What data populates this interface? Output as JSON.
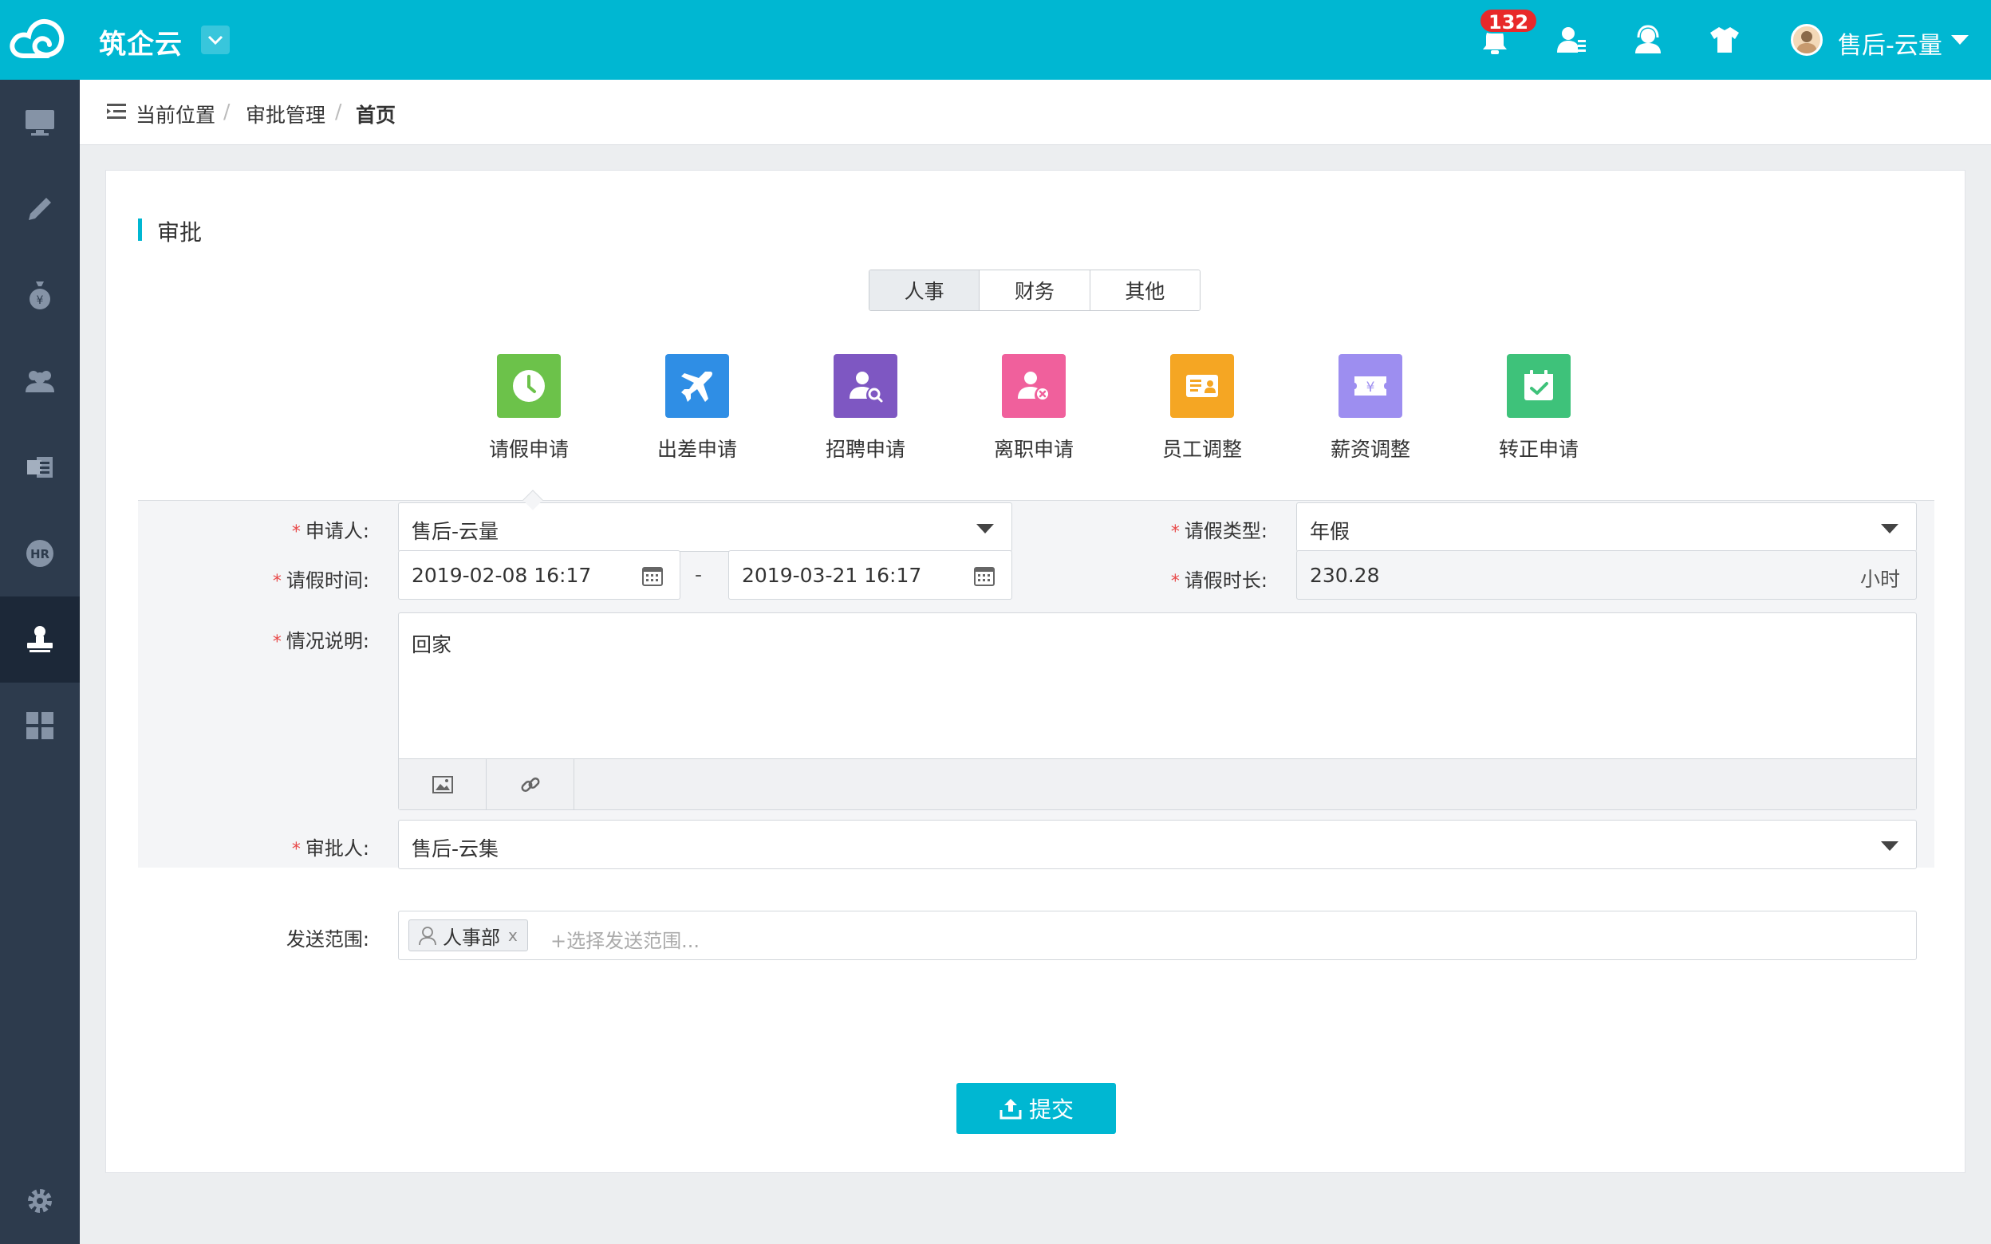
{
  "header": {
    "app_name": "筑企云",
    "notification_count": "132",
    "user_name": "售后-云量",
    "icons": [
      "cloud-logo-icon",
      "chevron-down-icon",
      "bell-icon",
      "contacts-icon",
      "headset-icon",
      "shirt-icon",
      "avatar"
    ]
  },
  "sidebar": {
    "items": [
      {
        "name": "monitor-icon"
      },
      {
        "name": "pen-icon"
      },
      {
        "name": "moneybag-icon"
      },
      {
        "name": "people-icon"
      },
      {
        "name": "office-icon"
      },
      {
        "name": "hr-icon",
        "text": "HR"
      },
      {
        "name": "stamp-icon",
        "active": true
      },
      {
        "name": "grid-icon"
      }
    ],
    "bottom": "gear-icon"
  },
  "breadcrumb": {
    "label": "当前位置",
    "items": [
      "审批管理",
      "首页"
    ]
  },
  "section": {
    "title": "审批"
  },
  "tabs": [
    "人事",
    "财务",
    "其他"
  ],
  "apps": [
    {
      "label": "请假申请",
      "color": "#6cc24a",
      "icon": "clock-icon"
    },
    {
      "label": "出差申请",
      "color": "#2f8ee5",
      "icon": "airplane-icon"
    },
    {
      "label": "招聘申请",
      "color": "#7e57c2",
      "icon": "person-search-icon"
    },
    {
      "label": "离职申请",
      "color": "#f0609c",
      "icon": "person-remove-icon"
    },
    {
      "label": "员工调整",
      "color": "#f5a623",
      "icon": "id-card-icon"
    },
    {
      "label": "薪资调整",
      "color": "#9d8ef0",
      "icon": "yuan-ticket-icon"
    },
    {
      "label": "转正申请",
      "color": "#3ec27a",
      "icon": "calendar-check-icon"
    }
  ],
  "form": {
    "applicant": {
      "label": "申请人:",
      "value": "售后-云量"
    },
    "leave_type": {
      "label": "请假类型:",
      "value": "年假"
    },
    "leave_time": {
      "label": "请假时间:",
      "start": "2019-02-08 16:17",
      "separator": "-",
      "end": "2019-03-21 16:17"
    },
    "duration": {
      "label": "请假时长:",
      "value": "230.28",
      "unit": "小时"
    },
    "description": {
      "label": "情况说明:",
      "value": "回家"
    },
    "approver": {
      "label": "审批人:",
      "value": "售后-云集"
    },
    "scope": {
      "label": "发送范围:",
      "tag": "人事部",
      "tag_close": "x",
      "placeholder": "+选择发送范围..."
    }
  },
  "submit_label": "提交"
}
